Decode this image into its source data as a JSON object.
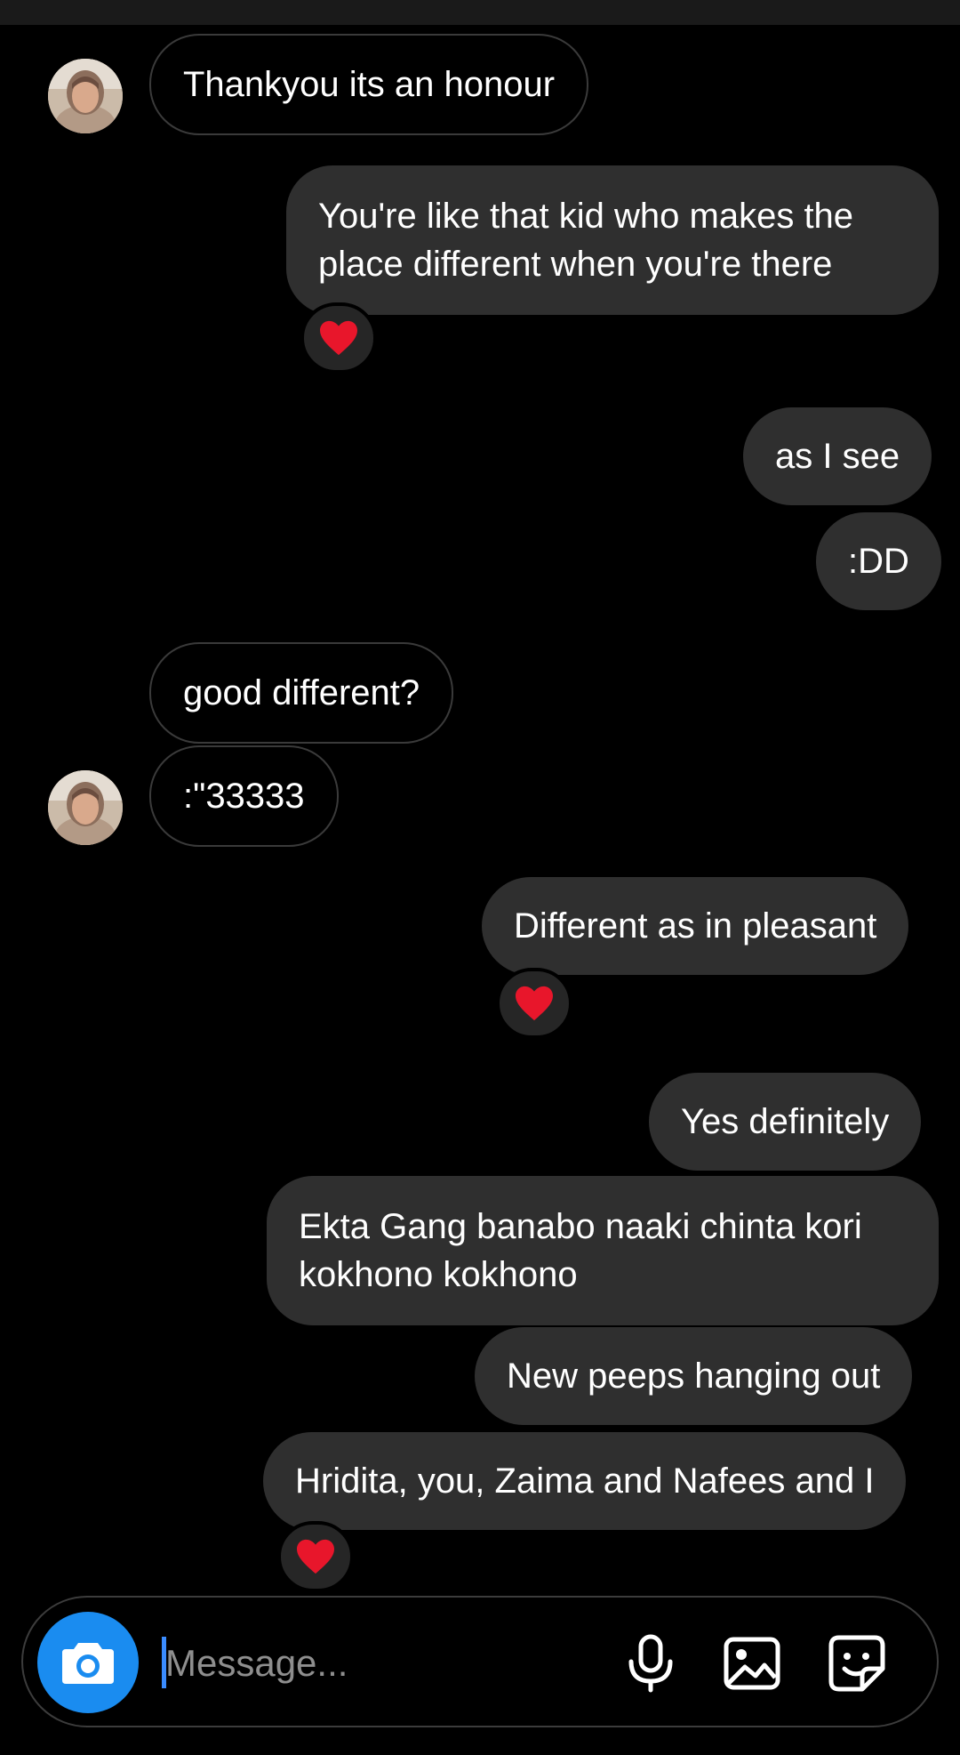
{
  "messages": [
    {
      "text": "Thankyou its an honour"
    },
    {
      "text": "You're like that kid who makes the place different when you're there",
      "reaction": "❤️"
    },
    {
      "text": "as I see"
    },
    {
      "text": ":DD"
    },
    {
      "text": "good different?"
    },
    {
      "text": ":\"33333"
    },
    {
      "text": "Different as in pleasant",
      "reaction": "❤️"
    },
    {
      "text": "Yes definitely"
    },
    {
      "text": "Ekta Gang banabo naaki chinta kori kokhono kokhono"
    },
    {
      "text": "New peeps hanging out"
    },
    {
      "text": "Hridita, you, Zaima and Nafees and I",
      "reaction": "❤️"
    }
  ],
  "composer": {
    "placeholder": "Message...",
    "icons": [
      "camera-icon",
      "microphone-icon",
      "gallery-icon",
      "sticker-icon"
    ]
  },
  "colors": {
    "background": "#000000",
    "outgoing_bubble": "#2f2f2f",
    "incoming_border": "#3a3a3a",
    "camera_button": "#1a8cf0",
    "heart": "#e8162b"
  }
}
